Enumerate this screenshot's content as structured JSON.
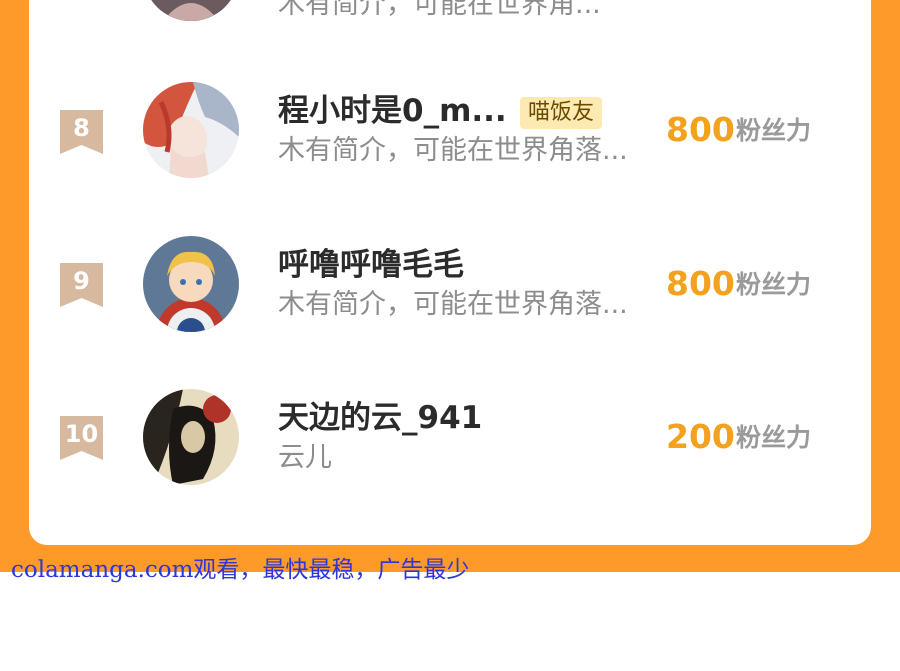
{
  "leaderboard": {
    "rows": [
      {
        "rank": "",
        "name": "",
        "badge": "",
        "bio": "木有简介，可能在世界角...",
        "fans": "",
        "fans_unit": ""
      },
      {
        "rank": "8",
        "name": "程小时是0_m...",
        "badge": "喵饭友",
        "bio": "木有简介，可能在世界角落...",
        "fans": "800",
        "fans_unit": "粉丝力"
      },
      {
        "rank": "9",
        "name": "呼噜呼噜毛毛",
        "badge": "",
        "bio": "木有简介，可能在世界角落...",
        "fans": "800",
        "fans_unit": "粉丝力"
      },
      {
        "rank": "10",
        "name": "天边的云_941",
        "badge": "",
        "bio": "云儿",
        "fans": "200",
        "fans_unit": "粉丝力"
      }
    ]
  },
  "colors": {
    "frame": "#fe9a29",
    "rank_ribbon": "#d7b9a0",
    "fans_number": "#f2a21c",
    "badge_bg": "#fdeab3",
    "footer_text": "#2d36d6"
  },
  "footer": {
    "watermark": "colamanga.com观看，最快最稳，广告最少"
  }
}
